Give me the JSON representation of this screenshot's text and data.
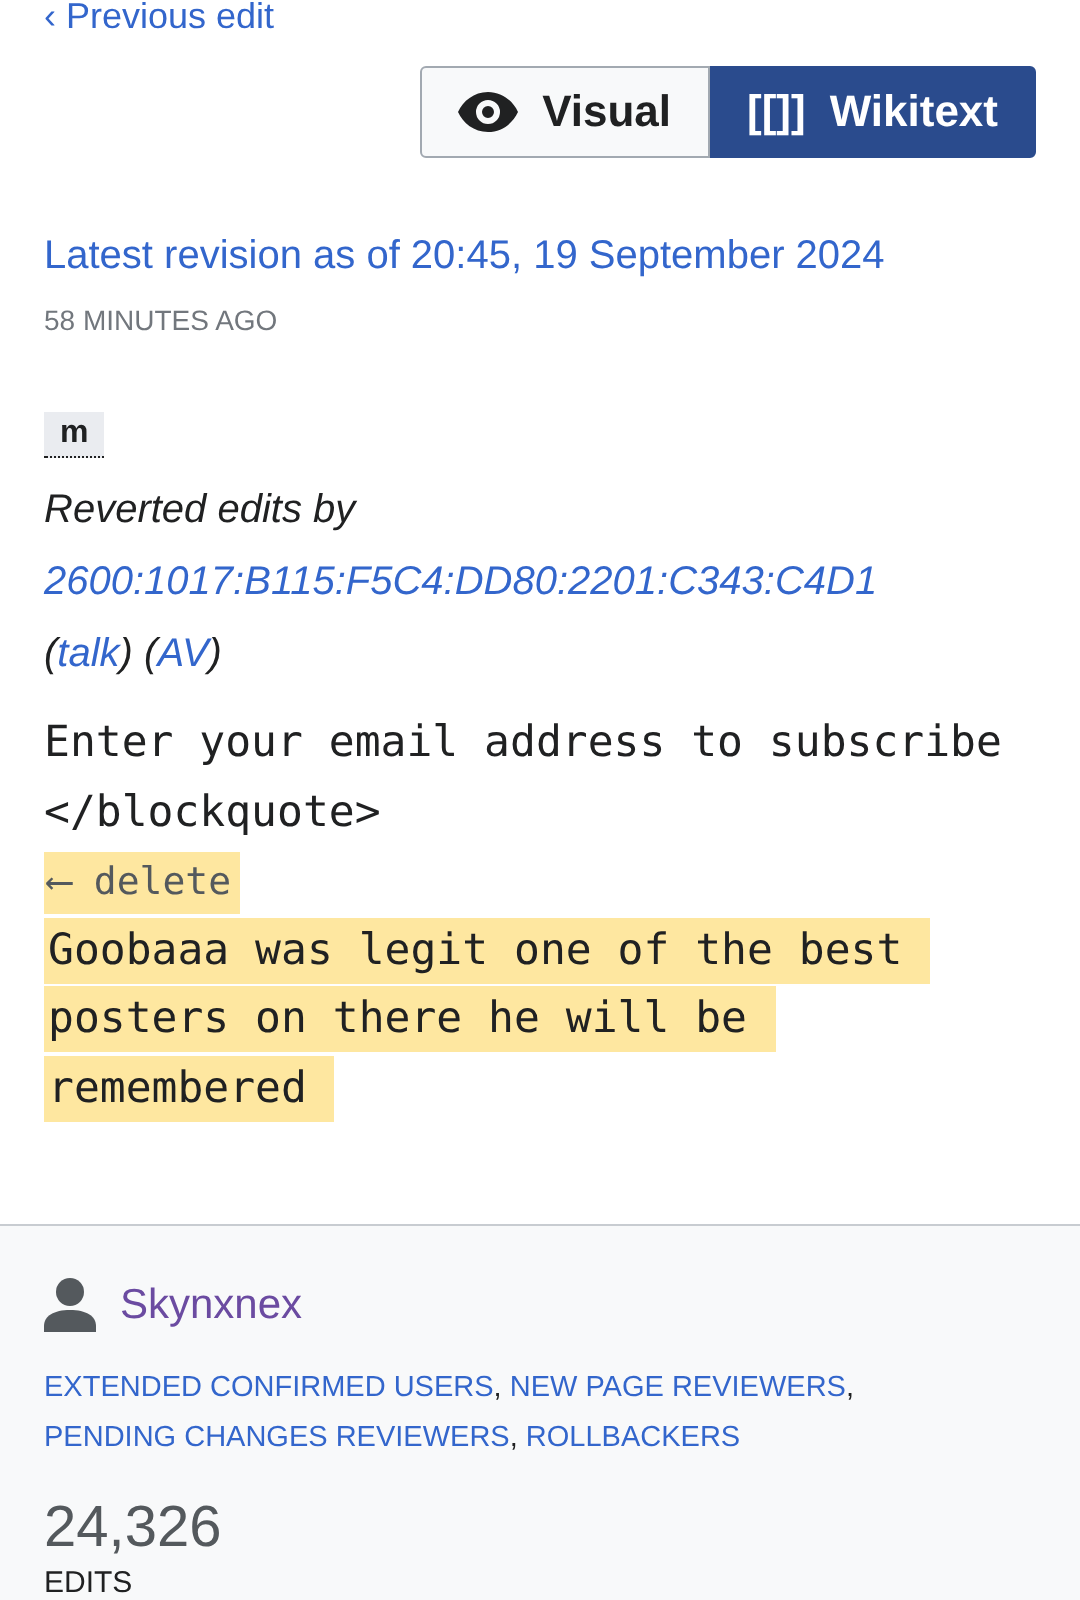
{
  "back_link": {
    "arrow": "‹",
    "label": "Previous edit"
  },
  "view_toggle": [
    {
      "kind": "eye",
      "label": "Visual",
      "selected": false
    },
    {
      "kind": "brackets",
      "glyph": "[[]]",
      "label": "Wikitext",
      "selected": true
    }
  ],
  "revision": {
    "title": "Latest revision as of 20:45, 19 September 2024",
    "age": "58 MINUTES AGO",
    "minor_badge": "m",
    "summary": "Reverted edits by",
    "author": "2600:1017:B115:F5C4:DD80:2201:C343:C4D1",
    "author_links": [
      {
        "open": "(",
        "label": "talk",
        "close": ")"
      },
      {
        "open": "(",
        "label": "AV",
        "close": ")"
      }
    ]
  },
  "diff": [
    {
      "kind": "context",
      "text": "Enter your email address to subscribe </blockquote>"
    },
    {
      "kind": "deleted",
      "marker": "⟵ delete",
      "text": "Goobaaa was legit one of the best posters on there he will be remembered"
    }
  ],
  "user_card": {
    "name": "Skynxnex",
    "group_separator": ",",
    "groups": [
      "EXTENDED CONFIRMED USERS",
      "NEW PAGE REVIEWERS",
      "PENDING CHANGES REVIEWERS",
      "ROLLBACKERS"
    ],
    "edit_count": "24,326",
    "edit_label": "EDITS"
  }
}
